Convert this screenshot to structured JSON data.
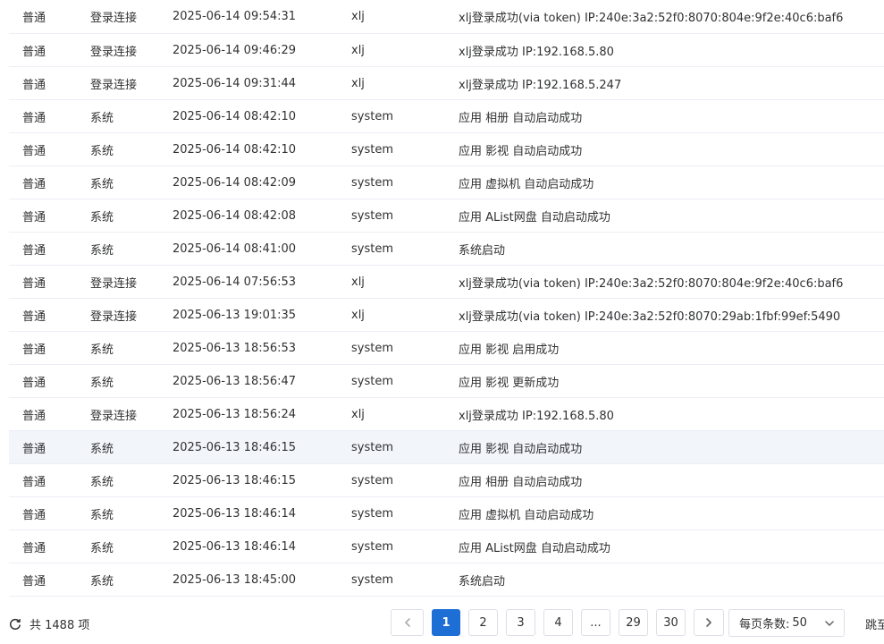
{
  "logs": [
    {
      "level": "普通",
      "category": "登录连接",
      "time": "2025-06-14 09:54:31",
      "user": "xlj",
      "message": "xlj登录成功(via token) IP:240e:3a2:52f0:8070:804e:9f2e:40c6:baf6"
    },
    {
      "level": "普通",
      "category": "登录连接",
      "time": "2025-06-14 09:46:29",
      "user": "xlj",
      "message": "xlj登录成功 IP:192.168.5.80"
    },
    {
      "level": "普通",
      "category": "登录连接",
      "time": "2025-06-14 09:31:44",
      "user": "xlj",
      "message": "xlj登录成功 IP:192.168.5.247"
    },
    {
      "level": "普通",
      "category": "系统",
      "time": "2025-06-14 08:42:10",
      "user": "system",
      "message": "应用 相册 自动启动成功"
    },
    {
      "level": "普通",
      "category": "系统",
      "time": "2025-06-14 08:42:10",
      "user": "system",
      "message": "应用 影视 自动启动成功"
    },
    {
      "level": "普通",
      "category": "系统",
      "time": "2025-06-14 08:42:09",
      "user": "system",
      "message": "应用 虚拟机 自动启动成功"
    },
    {
      "level": "普通",
      "category": "系统",
      "time": "2025-06-14 08:42:08",
      "user": "system",
      "message": "应用 AList网盘 自动启动成功"
    },
    {
      "level": "普通",
      "category": "系统",
      "time": "2025-06-14 08:41:00",
      "user": "system",
      "message": "系统启动"
    },
    {
      "level": "普通",
      "category": "登录连接",
      "time": "2025-06-14 07:56:53",
      "user": "xlj",
      "message": "xlj登录成功(via token) IP:240e:3a2:52f0:8070:804e:9f2e:40c6:baf6"
    },
    {
      "level": "普通",
      "category": "登录连接",
      "time": "2025-06-13 19:01:35",
      "user": "xlj",
      "message": "xlj登录成功(via token) IP:240e:3a2:52f0:8070:29ab:1fbf:99ef:5490"
    },
    {
      "level": "普通",
      "category": "系统",
      "time": "2025-06-13 18:56:53",
      "user": "system",
      "message": "应用 影视 启用成功"
    },
    {
      "level": "普通",
      "category": "系统",
      "time": "2025-06-13 18:56:47",
      "user": "system",
      "message": "应用 影视 更新成功"
    },
    {
      "level": "普通",
      "category": "登录连接",
      "time": "2025-06-13 18:56:24",
      "user": "xlj",
      "message": "xlj登录成功 IP:192.168.5.80"
    },
    {
      "level": "普通",
      "category": "系统",
      "time": "2025-06-13 18:46:15",
      "user": "system",
      "message": "应用 影视 自动启动成功"
    },
    {
      "level": "普通",
      "category": "系统",
      "time": "2025-06-13 18:46:15",
      "user": "system",
      "message": "应用 相册 自动启动成功"
    },
    {
      "level": "普通",
      "category": "系统",
      "time": "2025-06-13 18:46:14",
      "user": "system",
      "message": "应用 虚拟机 自动启动成功"
    },
    {
      "level": "普通",
      "category": "系统",
      "time": "2025-06-13 18:46:14",
      "user": "system",
      "message": "应用 AList网盘 自动启动成功"
    },
    {
      "level": "普通",
      "category": "系统",
      "time": "2025-06-13 18:45:00",
      "user": "system",
      "message": "系统启动"
    }
  ],
  "highlighted_row": 13,
  "footer": {
    "total_text": "共 1488 项",
    "refresh_icon": "refresh-icon",
    "pages": [
      "1",
      "2",
      "3",
      "4",
      "...",
      "29",
      "30"
    ],
    "current_page": "1",
    "prev_icon": "chevron-left-icon",
    "next_icon": "chevron-right-icon",
    "page_size_label": "每页条数:",
    "page_size_value": "50",
    "page_size_icon": "chevron-down-icon",
    "jump_label": "跳至"
  },
  "colors": {
    "accent": "#1d6fd6",
    "row_highlight": "#f2f5fa",
    "border": "#dcdfe6"
  }
}
